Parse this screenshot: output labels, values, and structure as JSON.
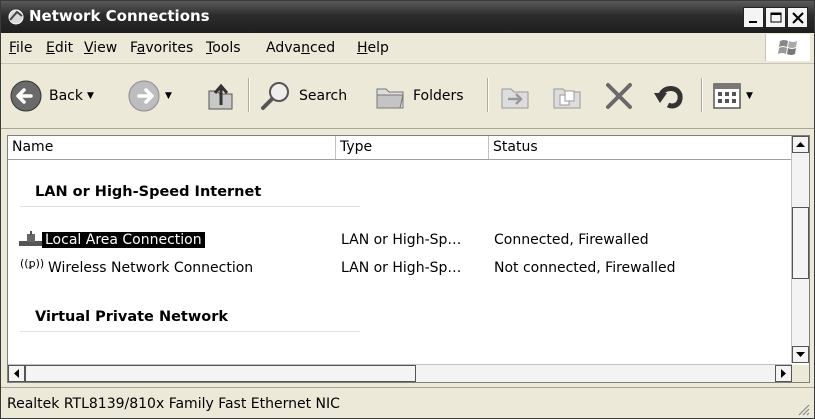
{
  "window": {
    "title": "Network Connections"
  },
  "menu": {
    "items": [
      {
        "label": "File",
        "accel": "F",
        "rest": "ile"
      },
      {
        "label": "Edit",
        "accel": "E",
        "rest": "dit"
      },
      {
        "label": "View",
        "accel": "V",
        "rest": "iew"
      },
      {
        "label": "Favorites",
        "pre": "F",
        "accel": "a",
        "rest": "vorites"
      },
      {
        "label": "Tools",
        "accel": "T",
        "rest": "ools"
      },
      {
        "label": "Advanced",
        "pre": "Adva",
        "accel": "n",
        "rest": "ced"
      },
      {
        "label": "Help",
        "accel": "H",
        "rest": "elp"
      }
    ]
  },
  "toolbar": {
    "back_label": "Back",
    "search_label": "Search",
    "folders_label": "Folders"
  },
  "list": {
    "columns": [
      "Name",
      "Type",
      "Status"
    ],
    "groups": [
      {
        "title": "LAN or High-Speed Internet",
        "rows": [
          {
            "name": "Local Area Connection",
            "type": "LAN or High-Sp…",
            "status": "Connected, Firewalled",
            "icon": "lan-connection-icon",
            "selected": true
          },
          {
            "name": "Wireless Network Connection",
            "type": "LAN or High-Sp…",
            "status": "Not connected, Firewalled",
            "icon": "wireless-connection-icon",
            "selected": false
          }
        ]
      },
      {
        "title": "Virtual Private Network",
        "rows": []
      }
    ]
  },
  "status_bar": {
    "text": "Realtek RTL8139/810x Family Fast Ethernet NIC"
  }
}
